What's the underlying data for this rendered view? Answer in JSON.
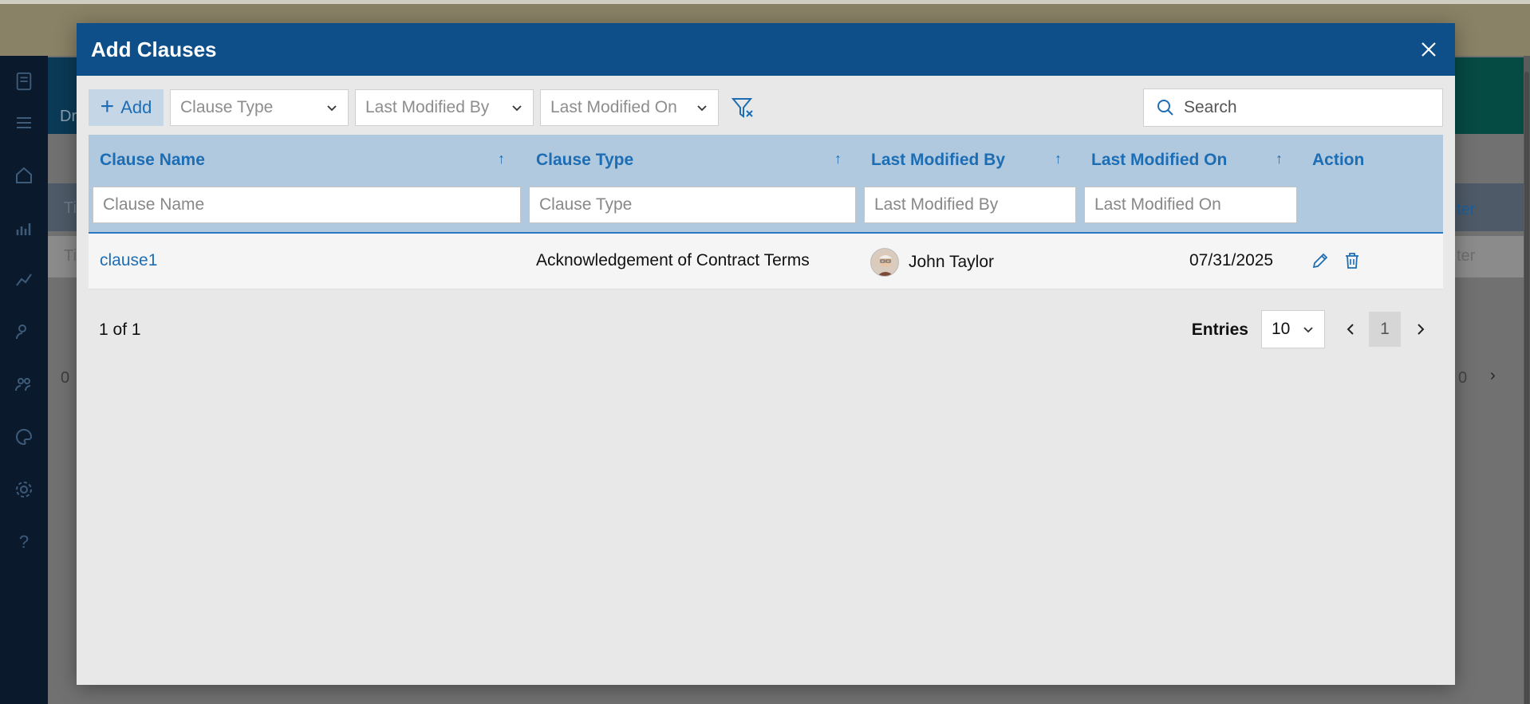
{
  "background": {
    "row_labels": [
      "Dr",
      "Ti",
      "Ti"
    ],
    "count_text": "0",
    "right_labels": [
      "ter",
      "ter"
    ],
    "pager_number": "0"
  },
  "modal": {
    "title": "Add Clauses"
  },
  "toolbar": {
    "add_label": "Add",
    "filters": [
      {
        "placeholder": "Clause Type"
      },
      {
        "placeholder": "Last Modified By"
      },
      {
        "placeholder": "Last Modified On"
      }
    ],
    "search_placeholder": "Search"
  },
  "table": {
    "columns": [
      {
        "title": "Clause Name",
        "filter_placeholder": "Clause Name"
      },
      {
        "title": "Clause Type",
        "filter_placeholder": "Clause Type"
      },
      {
        "title": "Last Modified By",
        "filter_placeholder": "Last Modified By"
      },
      {
        "title": "Last Modified On",
        "filter_placeholder": "Last Modified On"
      },
      {
        "title": "Action"
      }
    ],
    "rows": [
      {
        "clause_name": "clause1",
        "clause_type": "Acknowledgement of Contract Terms",
        "modified_by": "John Taylor",
        "modified_on": "07/31/2025"
      }
    ]
  },
  "pager": {
    "count_text": "1 of 1",
    "entries_label": "Entries",
    "entries_value": "10",
    "current_page": "1"
  },
  "colors": {
    "header": "#0e4f8a",
    "accent": "#1d6db4",
    "grid_header": "#b1c9de"
  }
}
